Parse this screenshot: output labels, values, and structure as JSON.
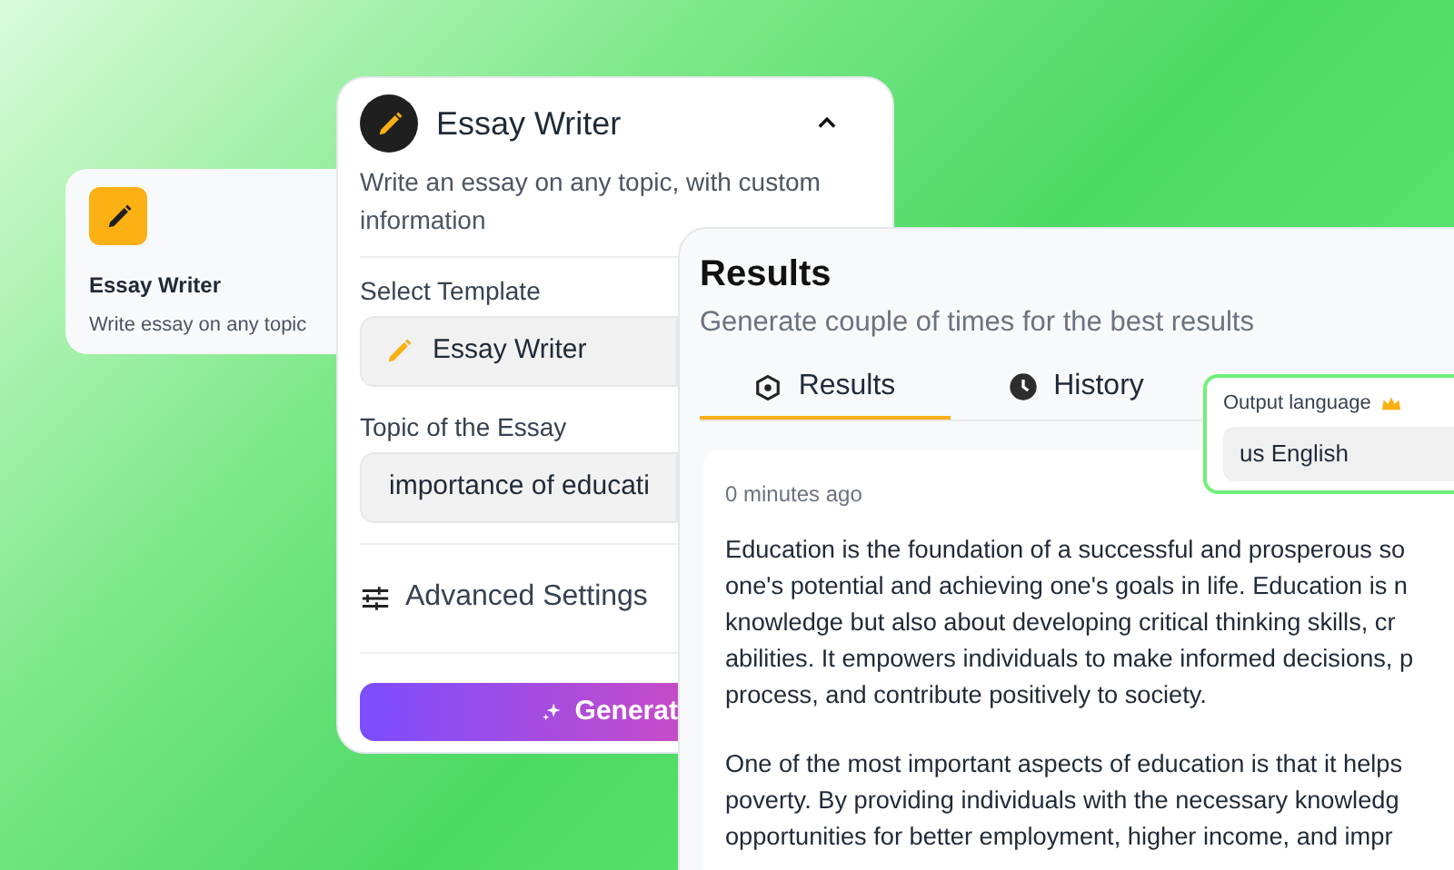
{
  "template_card": {
    "title": "Essay Writer",
    "description": "Write essay on any topic"
  },
  "essay_writer_panel": {
    "title": "Essay Writer",
    "expanded": true,
    "description": "Write an essay on any topic, with custom information",
    "fields": [
      {
        "kind": "select",
        "label": "Select Template",
        "value": "Essay Writer"
      },
      {
        "kind": "text",
        "label": "Topic of the Essay",
        "value": "importance of educati"
      }
    ],
    "advanced_settings": "Advanced Settings",
    "generate_button": "Generat"
  },
  "results_panel": {
    "title": "Results",
    "subtitle": "Generate couple of times for the best results",
    "tabs": [
      {
        "label": "Results",
        "selected": true
      },
      {
        "label": "History",
        "selected": false
      }
    ],
    "output_language": {
      "label": "Output language",
      "value": "us English"
    },
    "result": {
      "time": "0 minutes ago",
      "paragraphs": [
        [
          "Education is the foundation of a successful and prosperous so",
          "one's potential and achieving one's goals in life. Education is n",
          "knowledge but also about developing critical thinking skills, cr",
          "abilities. It empowers individuals to make informed decisions, p",
          "process, and contribute positively to society."
        ],
        [
          "One of the most important aspects of education is that it helps",
          "poverty. By providing individuals with the necessary knowledg",
          "opportunities for better employment, higher income, and impr"
        ]
      ]
    }
  }
}
